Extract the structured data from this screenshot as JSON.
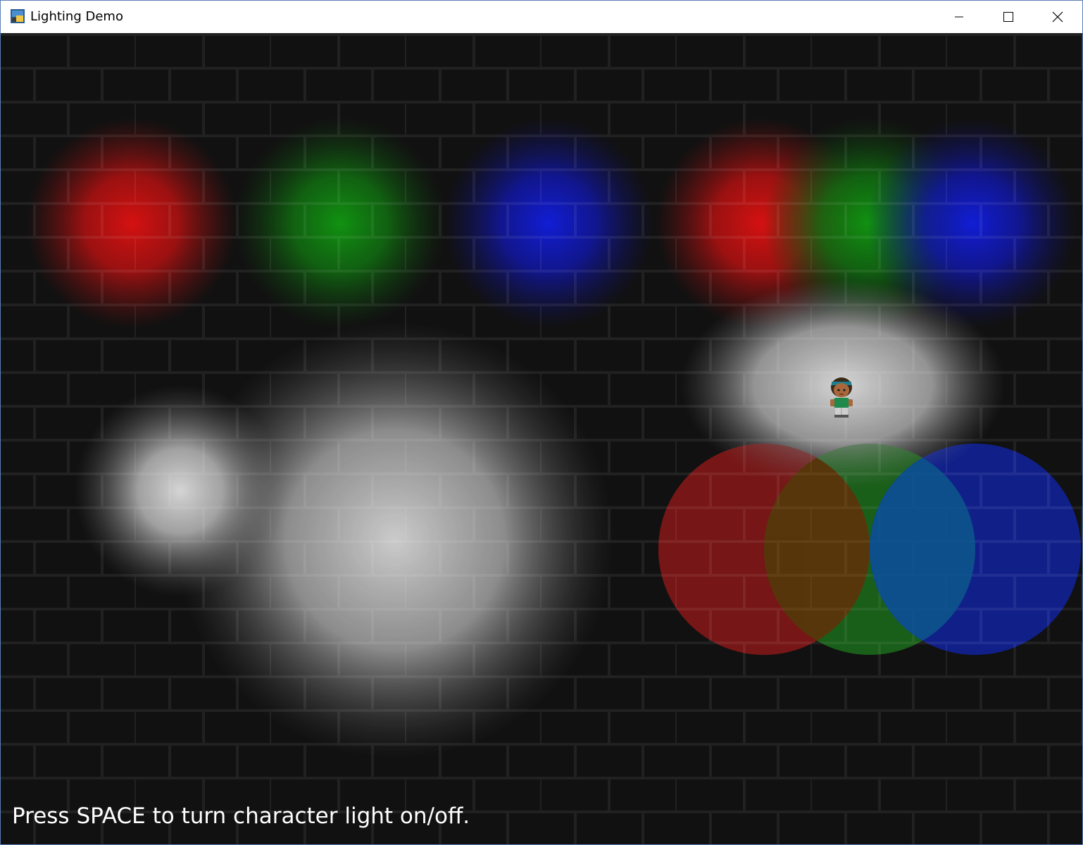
{
  "window": {
    "title": "Lighting Demo",
    "icon": "python-app-icon",
    "controls": [
      "minimize",
      "maximize",
      "close"
    ]
  },
  "game": {
    "hint_text": "Press SPACE to turn character light on/off.",
    "colors": {
      "background": "#0b0b0b",
      "brick_face": "#141414",
      "mortar": "#2a2a2a",
      "red": "#ff0000",
      "green": "#00aa00",
      "blue": "#0022ff",
      "white": "#ffffff",
      "orange": "#ff9a00",
      "cyan": "#1aa0ff"
    }
  }
}
